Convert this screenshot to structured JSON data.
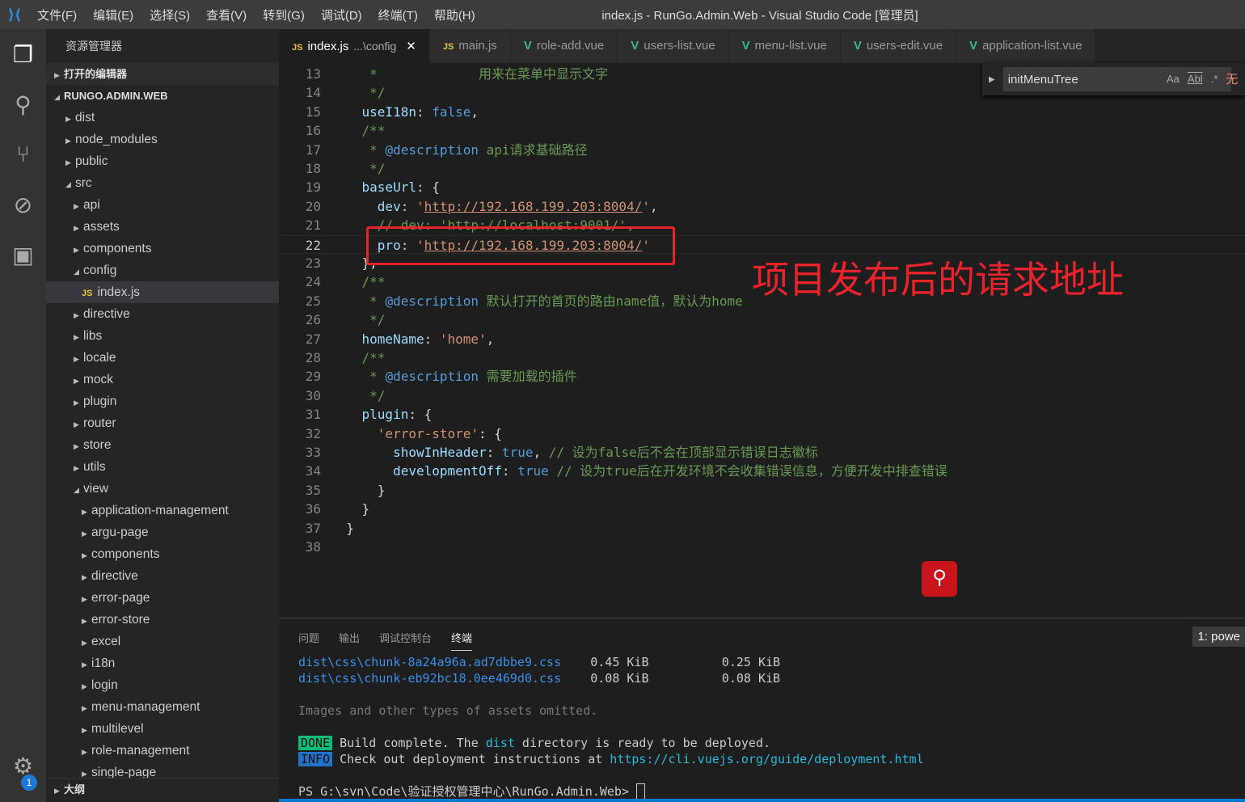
{
  "titlebar": {
    "menus": [
      "文件(F)",
      "编辑(E)",
      "选择(S)",
      "查看(V)",
      "转到(G)",
      "调试(D)",
      "终端(T)",
      "帮助(H)"
    ],
    "title": "index.js - RunGo.Admin.Web - Visual Studio Code [管理员]"
  },
  "activity": {
    "icons": [
      "files-icon",
      "search-icon",
      "source-control-icon",
      "debug-icon",
      "extensions-icon"
    ],
    "settings_badge": "1"
  },
  "explorer": {
    "header": "资源管理器",
    "open_editors": "打开的编辑器",
    "project": "RUNGO.ADMIN.WEB",
    "outline": "大纲",
    "tree": [
      {
        "label": "dist",
        "depth": 0,
        "open": false
      },
      {
        "label": "node_modules",
        "depth": 0,
        "open": false
      },
      {
        "label": "public",
        "depth": 0,
        "open": false
      },
      {
        "label": "src",
        "depth": 0,
        "open": true
      },
      {
        "label": "api",
        "depth": 1,
        "open": false
      },
      {
        "label": "assets",
        "depth": 1,
        "open": false
      },
      {
        "label": "components",
        "depth": 1,
        "open": false
      },
      {
        "label": "config",
        "depth": 1,
        "open": true
      },
      {
        "label": "index.js",
        "depth": 2,
        "file": true,
        "selected": true
      },
      {
        "label": "directive",
        "depth": 1,
        "open": false
      },
      {
        "label": "libs",
        "depth": 1,
        "open": false
      },
      {
        "label": "locale",
        "depth": 1,
        "open": false
      },
      {
        "label": "mock",
        "depth": 1,
        "open": false
      },
      {
        "label": "plugin",
        "depth": 1,
        "open": false
      },
      {
        "label": "router",
        "depth": 1,
        "open": false
      },
      {
        "label": "store",
        "depth": 1,
        "open": false
      },
      {
        "label": "utils",
        "depth": 1,
        "open": false
      },
      {
        "label": "view",
        "depth": 1,
        "open": true
      },
      {
        "label": "application-management",
        "depth": 2,
        "open": false
      },
      {
        "label": "argu-page",
        "depth": 2,
        "open": false
      },
      {
        "label": "components",
        "depth": 2,
        "open": false
      },
      {
        "label": "directive",
        "depth": 2,
        "open": false
      },
      {
        "label": "error-page",
        "depth": 2,
        "open": false
      },
      {
        "label": "error-store",
        "depth": 2,
        "open": false
      },
      {
        "label": "excel",
        "depth": 2,
        "open": false
      },
      {
        "label": "i18n",
        "depth": 2,
        "open": false
      },
      {
        "label": "login",
        "depth": 2,
        "open": false
      },
      {
        "label": "menu-management",
        "depth": 2,
        "open": false
      },
      {
        "label": "multilevel",
        "depth": 2,
        "open": false
      },
      {
        "label": "role-management",
        "depth": 2,
        "open": false
      },
      {
        "label": "single-page",
        "depth": 2,
        "open": false
      }
    ]
  },
  "tabs": [
    {
      "label": "index.js",
      "suffix": "...\\config",
      "type": "js",
      "active": true
    },
    {
      "label": "main.js",
      "type": "js"
    },
    {
      "label": "role-add.vue",
      "type": "vue"
    },
    {
      "label": "users-list.vue",
      "type": "vue"
    },
    {
      "label": "menu-list.vue",
      "type": "vue"
    },
    {
      "label": "users-edit.vue",
      "type": "vue"
    },
    {
      "label": "application-list.vue",
      "type": "vue"
    }
  ],
  "find": {
    "value": "initMenuTree",
    "match_case": "Aa",
    "whole_word": "Abl",
    "regex": ".*",
    "result": "无"
  },
  "code": {
    "current_line": 22,
    "lines": [
      {
        "n": "13",
        "t": [
          [
            "c",
            "     *             用来在菜单中显示文字"
          ]
        ]
      },
      {
        "n": "14",
        "t": [
          [
            "c",
            "     */"
          ]
        ]
      },
      {
        "n": "15",
        "t": [
          [
            "k",
            "    useI18n"
          ],
          [
            "p",
            ": "
          ],
          [
            "b",
            "false"
          ],
          [
            "p",
            ","
          ]
        ]
      },
      {
        "n": "16",
        "t": [
          [
            "c",
            "    /**"
          ]
        ]
      },
      {
        "n": "17",
        "t": [
          [
            "c",
            "     * "
          ],
          [
            "b",
            "@description"
          ],
          [
            "c",
            " api请求基础路径"
          ]
        ]
      },
      {
        "n": "18",
        "t": [
          [
            "c",
            "     */"
          ]
        ]
      },
      {
        "n": "19",
        "t": [
          [
            "k",
            "    baseUrl"
          ],
          [
            "p",
            ": {"
          ]
        ]
      },
      {
        "n": "20",
        "t": [
          [
            "k",
            "      dev"
          ],
          [
            "p",
            ": "
          ],
          [
            "q",
            "'"
          ],
          [
            "s",
            "http://192.168.199.203:8004/"
          ],
          [
            "q",
            "'"
          ],
          [
            "p",
            ","
          ]
        ]
      },
      {
        "n": "21",
        "t": [
          [
            "c",
            "      // dev: 'http://localhost:9001/',"
          ]
        ]
      },
      {
        "n": "22",
        "t": [
          [
            "k",
            "      pro"
          ],
          [
            "p",
            ": "
          ],
          [
            "q",
            "'"
          ],
          [
            "s",
            "http://192.168.199.203:8004/"
          ],
          [
            "q",
            "'"
          ]
        ]
      },
      {
        "n": "23",
        "t": [
          [
            "p",
            "    },"
          ]
        ]
      },
      {
        "n": "24",
        "t": [
          [
            "c",
            "    /**"
          ]
        ]
      },
      {
        "n": "25",
        "t": [
          [
            "c",
            "     * "
          ],
          [
            "b",
            "@description"
          ],
          [
            "c",
            " 默认打开的首页的路由name值，默认为home"
          ]
        ]
      },
      {
        "n": "26",
        "t": [
          [
            "c",
            "     */"
          ]
        ]
      },
      {
        "n": "27",
        "t": [
          [
            "k",
            "    homeName"
          ],
          [
            "p",
            ": "
          ],
          [
            "q",
            "'home'"
          ],
          [
            "p",
            ","
          ]
        ]
      },
      {
        "n": "28",
        "t": [
          [
            "c",
            "    /**"
          ]
        ]
      },
      {
        "n": "29",
        "t": [
          [
            "c",
            "     * "
          ],
          [
            "b",
            "@description"
          ],
          [
            "c",
            " 需要加载的插件"
          ]
        ]
      },
      {
        "n": "30",
        "t": [
          [
            "c",
            "     */"
          ]
        ]
      },
      {
        "n": "31",
        "t": [
          [
            "k",
            "    plugin"
          ],
          [
            "p",
            ": {"
          ]
        ]
      },
      {
        "n": "32",
        "t": [
          [
            "q",
            "      'error-store'"
          ],
          [
            "p",
            ": {"
          ]
        ]
      },
      {
        "n": "33",
        "t": [
          [
            "k",
            "        showInHeader"
          ],
          [
            "p",
            ": "
          ],
          [
            "b",
            "true"
          ],
          [
            "p",
            ", "
          ],
          [
            "c",
            "// 设为false后不会在顶部显示错误日志徽标"
          ]
        ]
      },
      {
        "n": "34",
        "t": [
          [
            "k",
            "        developmentOff"
          ],
          [
            "p",
            ": "
          ],
          [
            "b",
            "true"
          ],
          [
            "p",
            " "
          ],
          [
            "c",
            "// 设为true后在开发环境不会收集错误信息，方便开发中排查错误"
          ]
        ]
      },
      {
        "n": "35",
        "t": [
          [
            "p",
            "      }"
          ]
        ]
      },
      {
        "n": "36",
        "t": [
          [
            "p",
            "    }"
          ]
        ]
      },
      {
        "n": "37",
        "t": [
          [
            "p",
            "  }"
          ]
        ]
      },
      {
        "n": "38",
        "t": []
      }
    ]
  },
  "annotation": "项目发布后的请求地址",
  "panel": {
    "tabs": [
      "问题",
      "输出",
      "调试控制台",
      "终端"
    ],
    "active_tab": "终端",
    "terminal_select": "1: powe",
    "assets": [
      {
        "file": "dist\\css\\chunk-8a24a96a.ad7dbbe9.css",
        "size": "0.45 KiB",
        "gzip": "0.25 KiB"
      },
      {
        "file": "dist\\css\\chunk-eb92bc18.0ee469d0.css",
        "size": "0.08 KiB",
        "gzip": "0.08 KiB"
      }
    ],
    "omitted": "Images and other types of assets omitted.",
    "done_tag": "DONE",
    "done_pre": "Build complete. The ",
    "done_dist": "dist",
    "done_post": " directory is ready to be deployed.",
    "info_tag": "INFO",
    "info_text": "Check out deployment instructions at ",
    "info_link": "https://cli.vuejs.org/guide/deployment.html",
    "prompt": "PS G:\\svn\\Code\\验证授权管理中心\\RunGo.Admin.Web> "
  },
  "colors": {
    "accent": "#007acc",
    "annotation": "#e8232b",
    "vue": "#41b883",
    "js": "#e8c547"
  }
}
